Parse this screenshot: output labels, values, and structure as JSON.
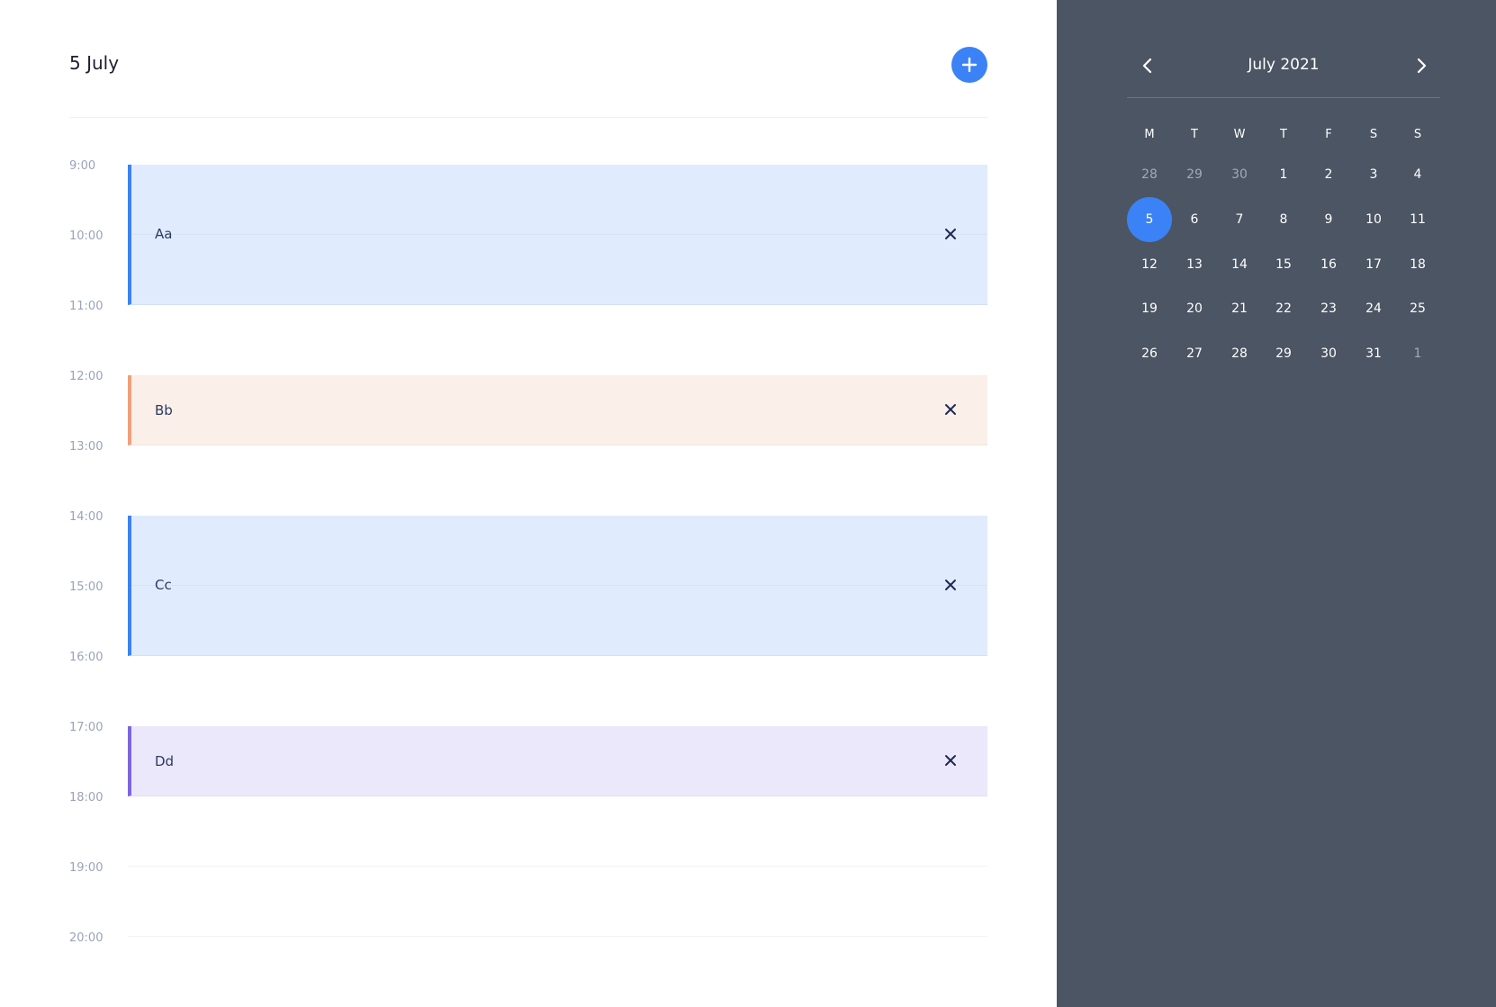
{
  "header": {
    "date_title": "5 July",
    "add_button_icon": "plus-icon"
  },
  "timeline": {
    "hours": [
      "9:00",
      "10:00",
      "11:00",
      "12:00",
      "13:00",
      "14:00",
      "15:00",
      "16:00",
      "17:00",
      "18:00",
      "19:00",
      "20:00"
    ],
    "events": [
      {
        "title": "Aa",
        "start": "9:00",
        "end": "11:00",
        "color": "#3b82f6",
        "close_icon": "close-icon"
      },
      {
        "title": "Bb",
        "start": "12:00",
        "end": "13:00",
        "color": "#f0a07a",
        "close_icon": "close-icon"
      },
      {
        "title": "Cc",
        "start": "14:00",
        "end": "16:00",
        "color": "#3b82f6",
        "close_icon": "close-icon"
      },
      {
        "title": "Dd",
        "start": "17:00",
        "end": "18:00",
        "color": "#7c66e0",
        "close_icon": "close-icon"
      }
    ]
  },
  "calendar": {
    "month_label": "July 2021",
    "prev_icon": "chevron-left-icon",
    "next_icon": "chevron-right-icon",
    "weekdays": [
      "M",
      "T",
      "W",
      "T",
      "F",
      "S",
      "S"
    ],
    "weeks": [
      [
        "28",
        "29",
        "30",
        "1",
        "2",
        "3",
        "4"
      ],
      [
        "5",
        "6",
        "7",
        "8",
        "9",
        "10",
        "11"
      ],
      [
        "12",
        "13",
        "14",
        "15",
        "16",
        "17",
        "18"
      ],
      [
        "19",
        "20",
        "21",
        "22",
        "23",
        "24",
        "25"
      ],
      [
        "26",
        "27",
        "28",
        "29",
        "30",
        "31",
        "1"
      ]
    ],
    "muted_days": [
      [
        0,
        0
      ],
      [
        0,
        1
      ],
      [
        0,
        2
      ],
      [
        4,
        6
      ]
    ],
    "selected_day": "5",
    "accent_color": "#3b82f6",
    "sidebar_color": "#4b5563"
  }
}
